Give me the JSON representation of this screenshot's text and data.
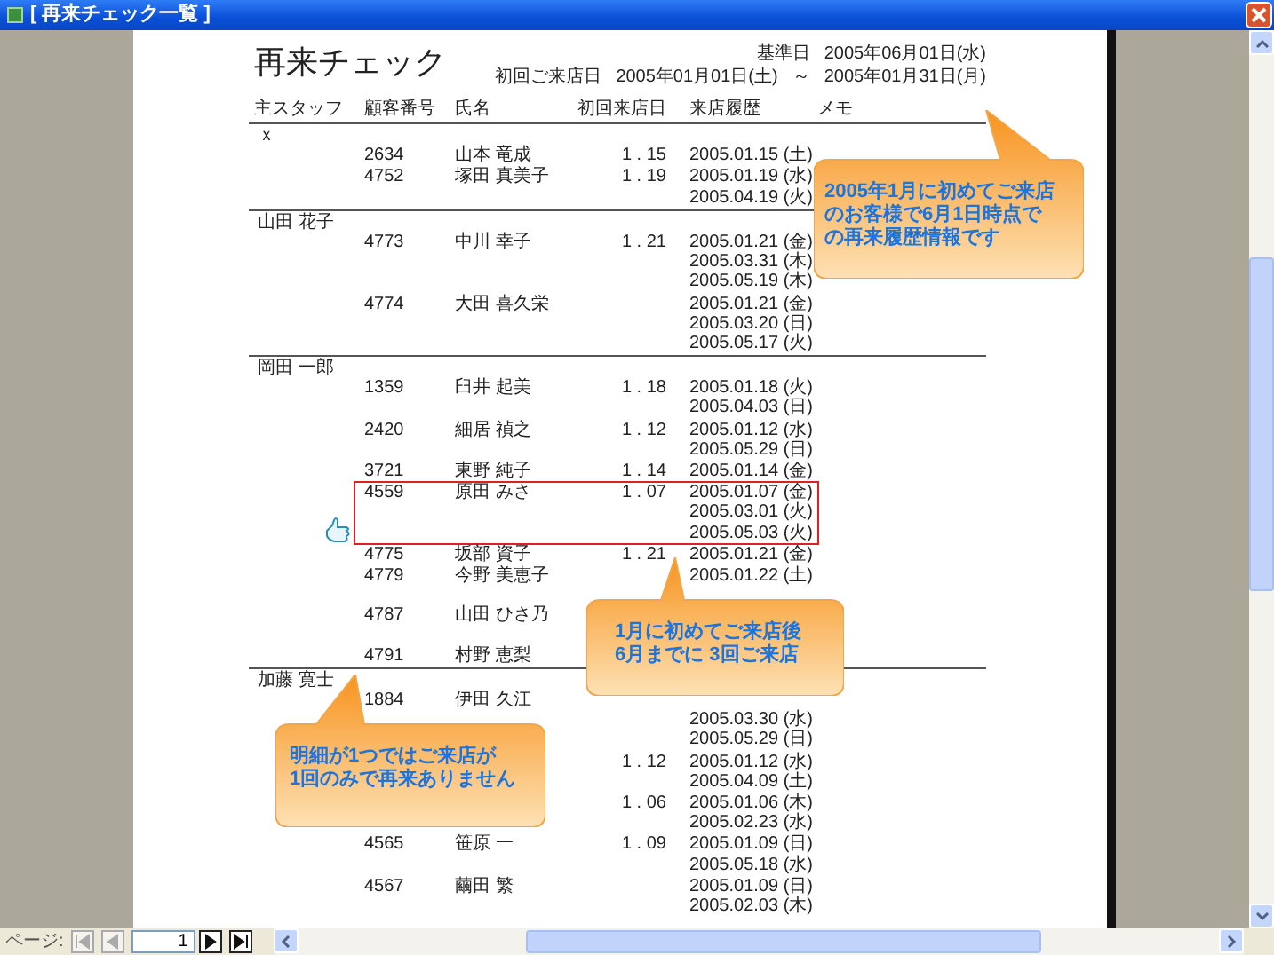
{
  "window": {
    "title": "[ 再来チェック一覧 ]"
  },
  "report": {
    "title": "再来チェック",
    "criteria": [
      {
        "label": "基準日",
        "value": "2005年06月01日(水)"
      },
      {
        "label": "初回ご来店日",
        "value": "2005年01月01日(土)",
        "separator": "～",
        "value_end": "2005年01月31日(月)"
      }
    ],
    "columns": [
      "主スタッフ",
      "顧客番号",
      "氏名",
      "初回来店日",
      "来店履歴",
      "メモ"
    ],
    "groups": [
      {
        "staff": "ｘ",
        "customers": [
          {
            "number": "2634",
            "name": "山本 竜成",
            "first_visit": "1 . 15",
            "history": [
              "2005.01.15 (土)"
            ],
            "highlighted": false
          },
          {
            "number": "4752",
            "name": "塚田 真美子",
            "first_visit": "1 . 19",
            "history": [
              "2005.01.19 (水)",
              "2005.04.19 (火)"
            ],
            "highlighted": false
          }
        ]
      },
      {
        "staff": "山田 花子",
        "customers": [
          {
            "number": "4773",
            "name": "中川 幸子",
            "first_visit": "1 . 21",
            "history": [
              "2005.01.21 (金)",
              "2005.03.31 (木)",
              "2005.05.19 (木)"
            ],
            "highlighted": false
          },
          {
            "number": "4774",
            "name": "大田 喜久栄",
            "history": [
              "2005.01.21 (金)",
              "2005.03.20 (日)",
              "2005.05.17 (火)"
            ],
            "highlighted": false
          }
        ]
      },
      {
        "staff": "岡田 一郎",
        "customers": [
          {
            "number": "1359",
            "name": "臼井 起美",
            "first_visit": "1 . 18",
            "history": [
              "2005.01.18 (火)",
              "2005.04.03 (日)"
            ],
            "highlighted": false
          },
          {
            "number": "2420",
            "name": "細居 禎之",
            "first_visit": "1 . 12",
            "history": [
              "2005.01.12 (水)",
              "2005.05.29 (日)"
            ],
            "highlighted": false
          },
          {
            "number": "3721",
            "name": "東野 純子",
            "first_visit": "1 . 14",
            "history": [
              "2005.01.14 (金)"
            ],
            "highlighted": false
          },
          {
            "number": "4559",
            "name": "原田 みさ",
            "first_visit": "1 . 07",
            "history": [
              "2005.01.07 (金)",
              "2005.03.01 (火)",
              "2005.05.03 (火)"
            ],
            "highlighted": true
          },
          {
            "number": "4775",
            "name": "坂部 資子",
            "first_visit": "1 . 21",
            "history": [
              "2005.01.21 (金)"
            ],
            "highlighted": false
          },
          {
            "number": "4779",
            "name": "今野 美恵子",
            "history": [
              "2005.01.22 (土)"
            ],
            "highlighted": false
          },
          {
            "number": "4787",
            "name": "山田 ひさ乃",
            "highlighted": false
          },
          {
            "number": "4791",
            "name": "村野 恵梨",
            "highlighted": false
          }
        ]
      },
      {
        "staff": "加藤 寛士",
        "customers": [
          {
            "number": "1884",
            "name": "伊田 久江",
            "history": [
              "2005.03.30 (水)",
              "2005.05.29 (日)"
            ],
            "highlighted": false
          },
          {
            "first_visit": "1 . 12",
            "history": [
              "2005.01.12 (水)",
              "2005.04.09 (土)"
            ],
            "highlighted": false
          },
          {
            "first_visit": "1 . 06",
            "history": [
              "2005.01.06 (木)",
              "2005.02.23 (水)"
            ],
            "highlighted": false
          },
          {
            "number": "4565",
            "name": "笹原 一",
            "first_visit": "1 . 09",
            "history": [
              "2005.01.09 (日)",
              "2005.05.18 (水)"
            ],
            "highlighted": false
          },
          {
            "number": "4567",
            "name": "繭田 繁",
            "history": [
              "2005.01.09 (日)",
              "2005.02.03 (木)"
            ],
            "highlighted": false
          }
        ]
      }
    ]
  },
  "callouts": [
    {
      "lines": [
        "2005年1月に初めてご来店",
        "のお客様で6月1日時点で",
        "の再来履歴情報です"
      ]
    },
    {
      "lines": [
        "1月に初めてご来店後",
        "6月までに 3回ご来店"
      ]
    },
    {
      "lines": [
        "明細が1つではご来店が",
        "1回のみで再来ありません"
      ]
    }
  ],
  "pager": {
    "label": "ページ:",
    "page": "1",
    "buttons": [
      {
        "kind": "first",
        "disabled": true
      },
      {
        "kind": "prev",
        "disabled": true
      },
      {
        "kind": "next",
        "disabled": false
      },
      {
        "kind": "last",
        "disabled": false
      }
    ]
  }
}
